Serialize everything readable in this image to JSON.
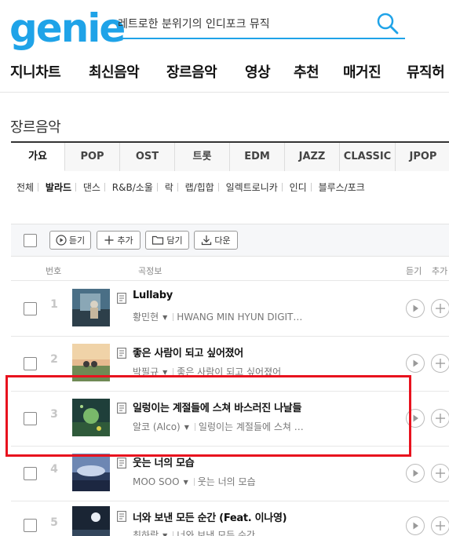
{
  "header": {
    "logo": "genie",
    "search": {
      "value": "레트로한 분위기의 인디포크 뮤직",
      "placeholder": ""
    }
  },
  "gnb": [
    "지니차트",
    "최신음악",
    "장르음악",
    "영상",
    "추천",
    "매거진",
    "뮤직허"
  ],
  "page_title": "장르음악",
  "genre_tabs": [
    "가요",
    "POP",
    "OST",
    "트롯",
    "EDM",
    "JAZZ",
    "CLASSIC",
    "JPOP"
  ],
  "active_genre_tab": "가요",
  "subgenres": [
    "전체",
    "발라드",
    "댄스",
    "R&B/소울",
    "락",
    "랩/힙합",
    "일렉트로니카",
    "인디",
    "블루스/포크"
  ],
  "active_subgenre": "발라드",
  "toolbar": {
    "listen": "듣기",
    "add": "추가",
    "keep": "담기",
    "download": "다운"
  },
  "columns": {
    "number": "번호",
    "info": "곡정보",
    "listen": "듣기",
    "add": "추가"
  },
  "songs": [
    {
      "rank": "1",
      "title": "Lullaby",
      "artist": "황민현",
      "album": "HWANG MIN HYUN DIGIT…"
    },
    {
      "rank": "2",
      "title": "좋은 사람이 되고 싶어졌어",
      "artist": "박필규",
      "album": "좋은 사람이 되고 싶어졌어"
    },
    {
      "rank": "3",
      "title": "일렁이는 계절들에 스쳐 바스러진 나날들",
      "artist": "알코 (Alco)",
      "album": "일렁이는 계절들에 스쳐 …"
    },
    {
      "rank": "4",
      "title": "웃는 너의 모습",
      "artist": "MOO SOO",
      "album": "웃는 너의 모습"
    },
    {
      "rank": "5",
      "title": "너와 보낸 모든 순간 (Feat. 이나영)",
      "artist": "최하람",
      "album": "너와 보낸 모든 순간"
    }
  ],
  "colors": {
    "brand": "#1fa3e8",
    "highlight": "#e8121e"
  },
  "icons": {
    "search": "search-icon",
    "play": "play-icon",
    "add": "plus-icon",
    "folder": "folder-icon",
    "download": "download-icon",
    "lyrics": "lyrics-icon"
  }
}
